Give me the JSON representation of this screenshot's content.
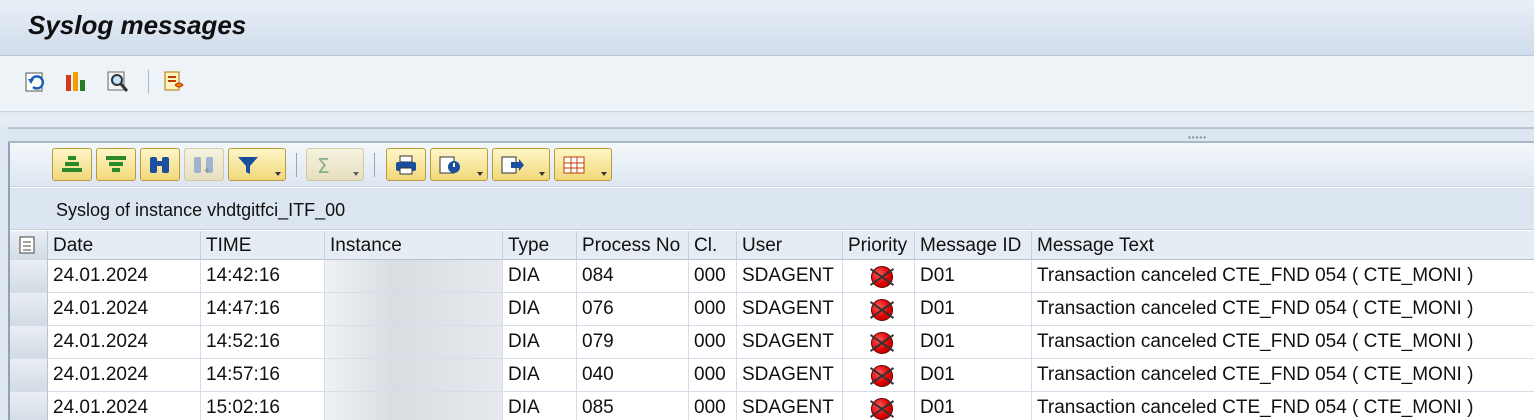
{
  "window": {
    "title": "Syslog messages"
  },
  "toolbar": {
    "items": [
      {
        "name": "refresh-icon"
      },
      {
        "name": "chart-icon"
      },
      {
        "name": "magnifier-icon"
      },
      {
        "name": "settings-icon"
      }
    ]
  },
  "alv_toolbar": {
    "buttons": [
      "sort-ascending",
      "sort-descending",
      "find",
      "find-next",
      "filter",
      "sum",
      "print",
      "view",
      "export",
      "layout"
    ]
  },
  "caption": "Syslog of instance vhdtgitfci_ITF_00",
  "table": {
    "columns": [
      "Date",
      "TIME",
      "Instance",
      "Type",
      "Process No",
      "Cl.",
      "User",
      "Priority",
      "Message ID",
      "Message Text"
    ],
    "rows": [
      {
        "date": "24.01.2024",
        "time": "14:42:16",
        "instance": "",
        "type": "DIA",
        "process_no": "084",
        "client": "000",
        "user": "SDAGENT",
        "message_id": "D01",
        "message_text": "Transaction canceled CTE_FND 054 ( CTE_MONI )"
      },
      {
        "date": "24.01.2024",
        "time": "14:47:16",
        "instance": "",
        "type": "DIA",
        "process_no": "076",
        "client": "000",
        "user": "SDAGENT",
        "message_id": "D01",
        "message_text": "Transaction canceled CTE_FND 054 ( CTE_MONI )"
      },
      {
        "date": "24.01.2024",
        "time": "14:52:16",
        "instance": "",
        "type": "DIA",
        "process_no": "079",
        "client": "000",
        "user": "SDAGENT",
        "message_id": "D01",
        "message_text": "Transaction canceled CTE_FND 054 ( CTE_MONI )"
      },
      {
        "date": "24.01.2024",
        "time": "14:57:16",
        "instance": "",
        "type": "DIA",
        "process_no": "040",
        "client": "000",
        "user": "SDAGENT",
        "message_id": "D01",
        "message_text": "Transaction canceled CTE_FND 054 ( CTE_MONI )"
      },
      {
        "date": "24.01.2024",
        "time": "15:02:16",
        "instance": "",
        "type": "DIA",
        "process_no": "085",
        "client": "000",
        "user": "SDAGENT",
        "message_id": "D01",
        "message_text": "Transaction canceled CTE_FND 054 ( CTE_MONI )"
      }
    ]
  },
  "colors": {
    "priority_high": "#e00000",
    "alv_button": "#f2d77a"
  }
}
